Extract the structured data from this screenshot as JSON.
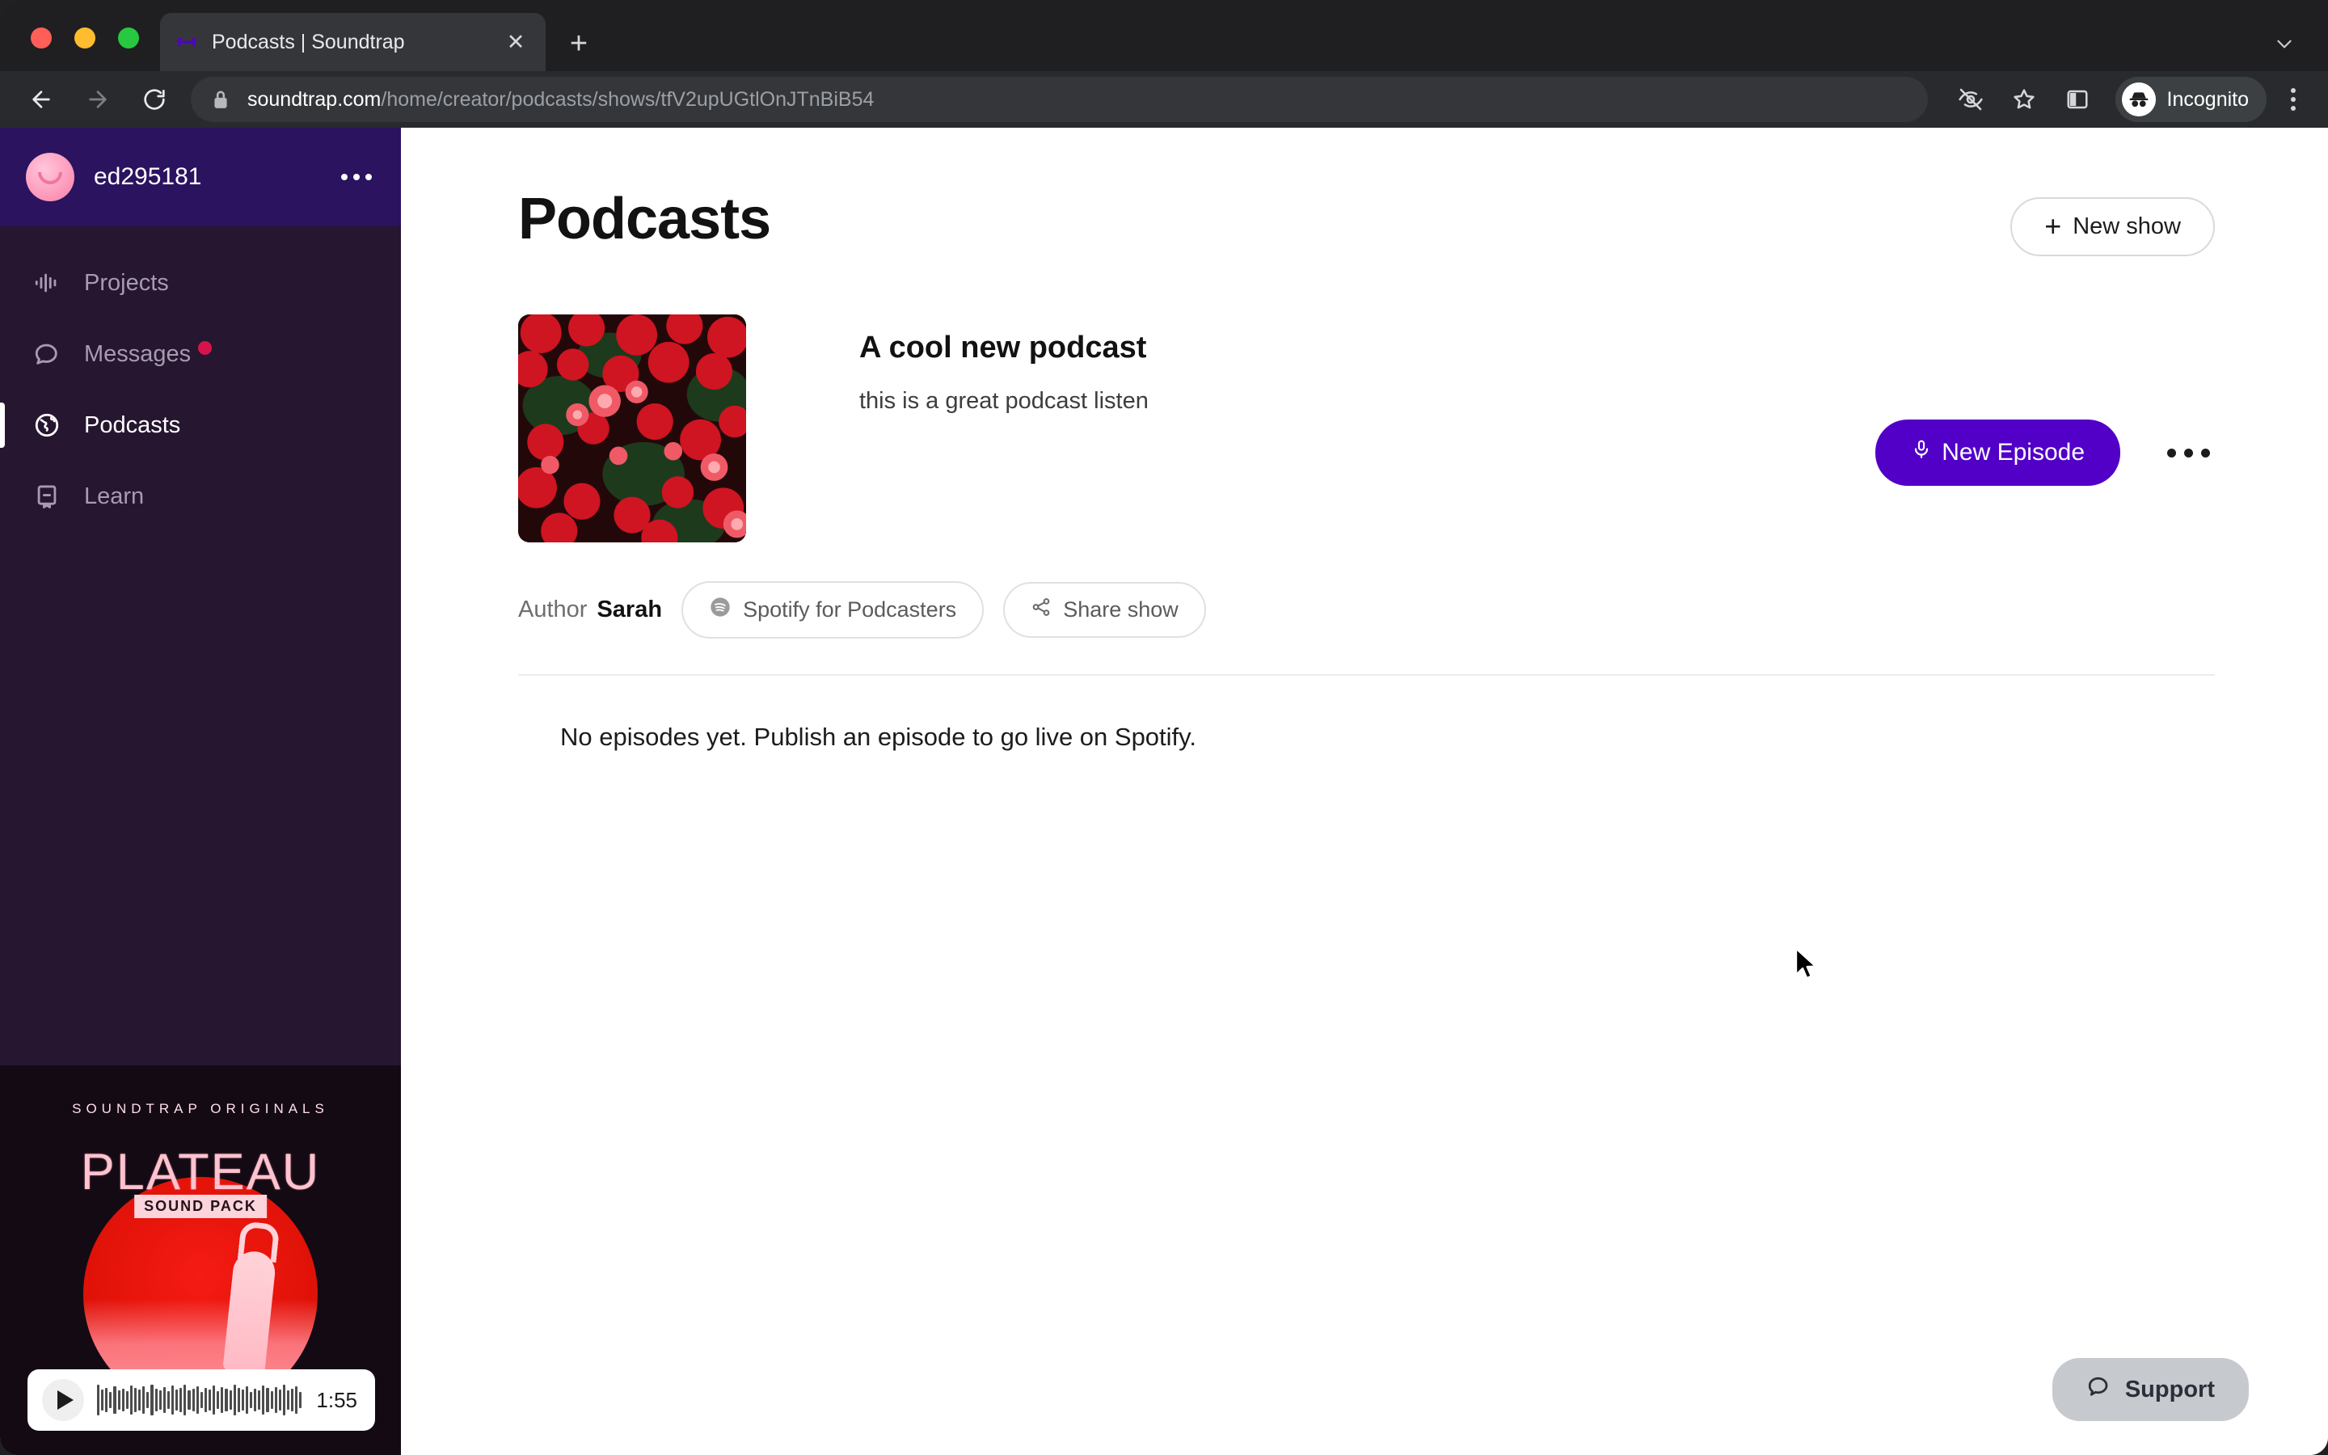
{
  "browser": {
    "tab": {
      "title": "Podcasts | Soundtrap",
      "favicon_icon": "soundtrap-logo-icon",
      "close_icon": "close-icon"
    },
    "new_tab_icon": "plus-icon",
    "tab_list_icon": "chevron-down-icon",
    "nav": {
      "back_icon": "arrow-left-icon",
      "forward_icon": "arrow-right-icon",
      "reload_icon": "reload-icon"
    },
    "omnibox": {
      "lock_icon": "lock-icon",
      "host": "soundtrap.com",
      "path": "/home/creator/podcasts/shows/tfV2upUGtlOnJTnBiB54"
    },
    "toolbar_icons": [
      "eye-off-icon",
      "bookmark-star-icon",
      "side-panel-icon"
    ],
    "profile": {
      "label": "Incognito",
      "icon": "incognito-icon"
    },
    "menu_icon": "kebab-vertical-icon"
  },
  "sidebar": {
    "user": {
      "name": "ed295181",
      "avatar_icon": "smiley-avatar",
      "menu_icon": "kebab-horizontal-icon"
    },
    "items": [
      {
        "label": "Projects",
        "icon": "waveform-icon",
        "active": false,
        "badge": false
      },
      {
        "label": "Messages",
        "icon": "chat-bubble-icon",
        "active": false,
        "badge": true
      },
      {
        "label": "Podcasts",
        "icon": "globe-icon",
        "active": true,
        "badge": false
      },
      {
        "label": "Learn",
        "icon": "book-icon",
        "active": false,
        "badge": false
      }
    ],
    "promo": {
      "kicker": "SOUNDTRAP ORIGINALS",
      "title": "PLATEAU",
      "subtitle": "SOUND PACK"
    },
    "player": {
      "play_icon": "play-icon",
      "duration": "1:55",
      "waveform": [
        38,
        26,
        30,
        20,
        34,
        24,
        28,
        22,
        36,
        30,
        26,
        34,
        20,
        38,
        28,
        24,
        32,
        22,
        36,
        26,
        30,
        38,
        24,
        28,
        34,
        20,
        30,
        26,
        36,
        22,
        32,
        28,
        24,
        38,
        30,
        26,
        34,
        20,
        28,
        24,
        36,
        30,
        22,
        32,
        26,
        38,
        24,
        28,
        34,
        20
      ]
    }
  },
  "main": {
    "page_title": "Podcasts",
    "new_show": {
      "label": "New show",
      "icon": "plus-icon"
    },
    "show": {
      "cover_icon": "podcast-cover-red-flowers",
      "title": "A cool new podcast",
      "description": "this is a great podcast listen",
      "new_episode": {
        "label": "New Episode",
        "icon": "microphone-icon"
      },
      "more_icon": "kebab-horizontal-icon"
    },
    "author": {
      "label": "Author",
      "name": "Sarah",
      "spotify_pill": {
        "label": "Spotify for Podcasters",
        "icon": "spotify-icon"
      },
      "share_pill": {
        "label": "Share show",
        "icon": "share-icon"
      }
    },
    "empty_state": "No episodes yet. Publish an episode to go live on Spotify."
  },
  "support": {
    "label": "Support",
    "icon": "chat-bubble-icon"
  },
  "colors": {
    "accent_purple": "#5200c8",
    "sidebar_bg": "#261630",
    "user_header_bg": "#2b1360",
    "badge_red": "#d6144b",
    "browser_chrome": "#292a2d"
  }
}
